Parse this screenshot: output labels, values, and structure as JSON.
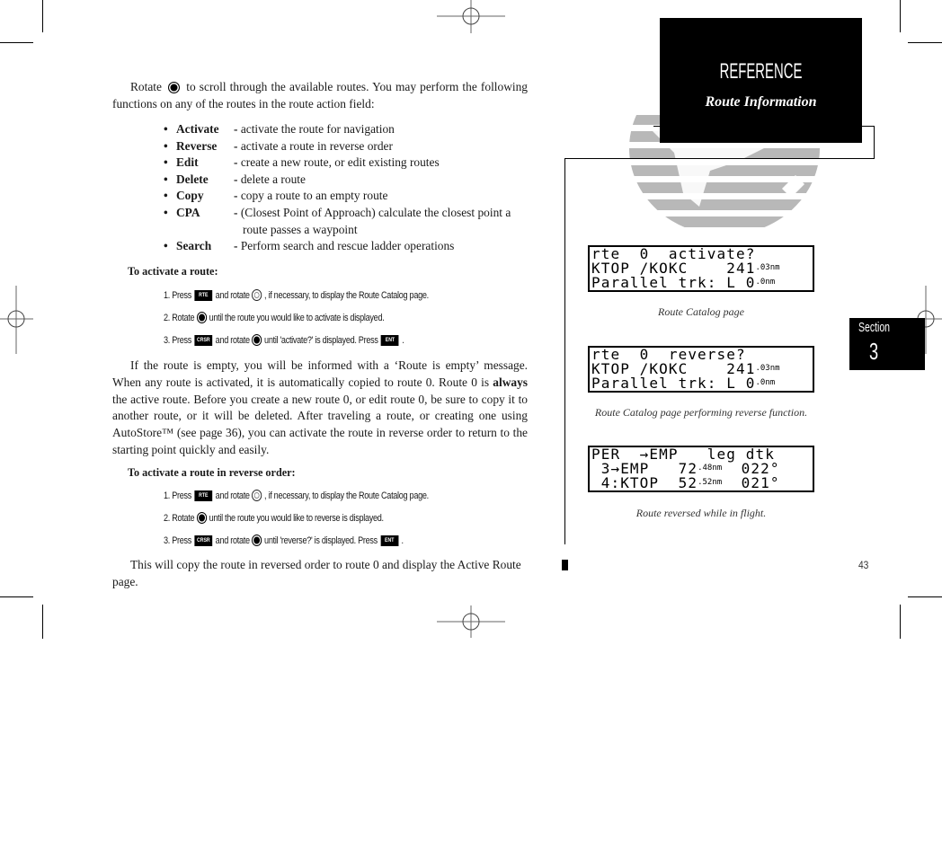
{
  "intro": {
    "before_knob": "Rotate",
    "after_knob": "to scroll through the available routes. You may perform the following functions on any of the routes in the route action field:"
  },
  "functions": [
    {
      "term": "Activate",
      "desc": "activate the route for navigation"
    },
    {
      "term": "Reverse",
      "desc": "activate a route in reverse order"
    },
    {
      "term": "Edit",
      "desc": "create a new route, or edit existing routes"
    },
    {
      "term": "Delete",
      "desc": "delete a route"
    },
    {
      "term": "Copy",
      "desc": "copy a route to an empty route"
    },
    {
      "term": "CPA",
      "desc": "(Closest Point of Approach) calculate the closest point a",
      "desc_cont": "route passes a waypoint"
    },
    {
      "term": "Search",
      "desc": "Perform search and rescue ladder operations"
    }
  ],
  "activate_section": {
    "heading": "To activate a route:",
    "steps": [
      {
        "num": "1. Press",
        "key": "RTE",
        "mid": "and rotate",
        "knob": "outline",
        "end": ", if necessary, to display the Route Catalog page."
      },
      {
        "num": "2. Rotate",
        "knob": "filled",
        "end": "until the route you would like to activate is displayed."
      },
      {
        "num": "3. Press",
        "key": "CRSR",
        "mid": "and rotate",
        "knob": "filled",
        "end": "until 'activate?' is displayed. Press",
        "key2": "ENT",
        "tail": "."
      }
    ]
  },
  "empty_para": {
    "part1": "If the route is empty, you will be informed with a ‘Route is empty’ message. When any route is activated, it is automatically copied to route 0. Route 0 is",
    "bold": "always",
    "part2": "the active route. Before you create a new route 0, or edit route 0, be sure to copy it to another route, or it will be deleted. After traveling a route, or creating one using AutoStore™ (see page 36), you can activate the route in reverse order to return to the starting point quickly and easily."
  },
  "reverse_section": {
    "heading": "To activate a route in reverse order:",
    "steps": [
      {
        "num": "1. Press",
        "key": "RTE",
        "mid": "and rotate",
        "knob": "outline",
        "end": ", if necessary, to display the Route Catalog page."
      },
      {
        "num": "2. Rotate",
        "knob": "filled",
        "end": "until the route you would like to reverse is displayed."
      },
      {
        "num": "3. Press",
        "key": "CRSR",
        "mid": "and rotate",
        "knob": "filled",
        "end": "until 'reverse?' is displayed. Press",
        "key2": "ENT",
        "tail": "."
      }
    ]
  },
  "closing_para": "This will copy the route in reversed order to route 0 and display the Active Route page.",
  "header": {
    "title": "REFERENCE",
    "subtitle": "Route Information"
  },
  "screens": [
    {
      "rows": [
        {
          "text": "rte  0  activate?"
        },
        {
          "text": "KTOP /KOKC    241",
          "small": ".03",
          "unit": "nm"
        },
        {
          "text": "Parallel trk: L 0",
          "small": ".0",
          "unit": "nm"
        }
      ],
      "caption": "Route Catalog page"
    },
    {
      "rows": [
        {
          "text": "rte  0  reverse?"
        },
        {
          "text": "KTOP /KOKC    241",
          "small": ".03",
          "unit": "nm"
        },
        {
          "text": "Parallel trk: L 0",
          "small": ".0",
          "unit": "nm"
        }
      ],
      "caption": "Route Catalog page performing reverse function."
    },
    {
      "rows": [
        {
          "text": "PER  →EMP   leg dtk"
        },
        {
          "text": " 3→EMP   72",
          "small": ".48",
          "unit": "nm",
          "tail": "  022°"
        },
        {
          "text": " 4:KTOP  52",
          "small": ".52",
          "unit": "nm",
          "tail": "  021°"
        }
      ],
      "caption": "Route reversed while in flight."
    }
  ],
  "section_tab": {
    "label": "Section",
    "number": "3"
  },
  "page_number": "43"
}
